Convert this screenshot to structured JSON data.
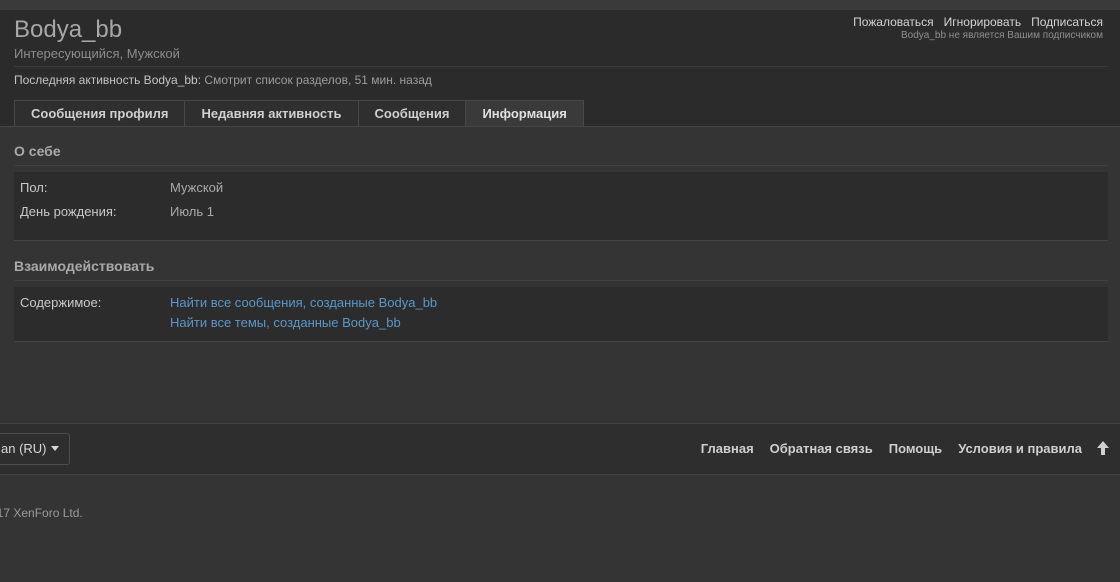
{
  "profile": {
    "username": "Bodya_bb",
    "user_title": "Интересующийся, Мужской",
    "actions": [
      "Пожаловаться",
      "Игнорировать",
      "Подписаться"
    ],
    "follow_note": "Bodya_bb не является Вашим подписчиком",
    "last_activity_label": "Последняя активность Bodya_bb:",
    "last_activity_value": "Смотрит список разделов, 51 мин. назад"
  },
  "tabs": [
    {
      "label": "Сообщения профиля",
      "active": false
    },
    {
      "label": "Недавняя активность",
      "active": false
    },
    {
      "label": "Сообщения",
      "active": false
    },
    {
      "label": "Информация",
      "active": true
    }
  ],
  "about": {
    "title": "О себе",
    "gender_label": "Пол:",
    "gender_value": "Мужской",
    "birthday_label": "День рождения:",
    "birthday_value": "Июль 1"
  },
  "interact": {
    "title": "Взаимодействовать",
    "content_label": "Содержимое:",
    "link_messages": "Найти все сообщения, созданные Bodya_bb",
    "link_threads": "Найти все темы, созданные Bodya_bb"
  },
  "footer": {
    "language": "an (RU)",
    "links": [
      "Главная",
      "Обратная связь",
      "Помощь",
      "Условия и правила"
    ],
    "copyright": "017 XenForo Ltd."
  },
  "icons": {
    "scroll_top": "arrow-up-icon",
    "dropdown": "chevron-down-icon"
  },
  "colors": {
    "link": "#5a97c8",
    "background": "#343434",
    "panel": "#2c2c2c"
  }
}
